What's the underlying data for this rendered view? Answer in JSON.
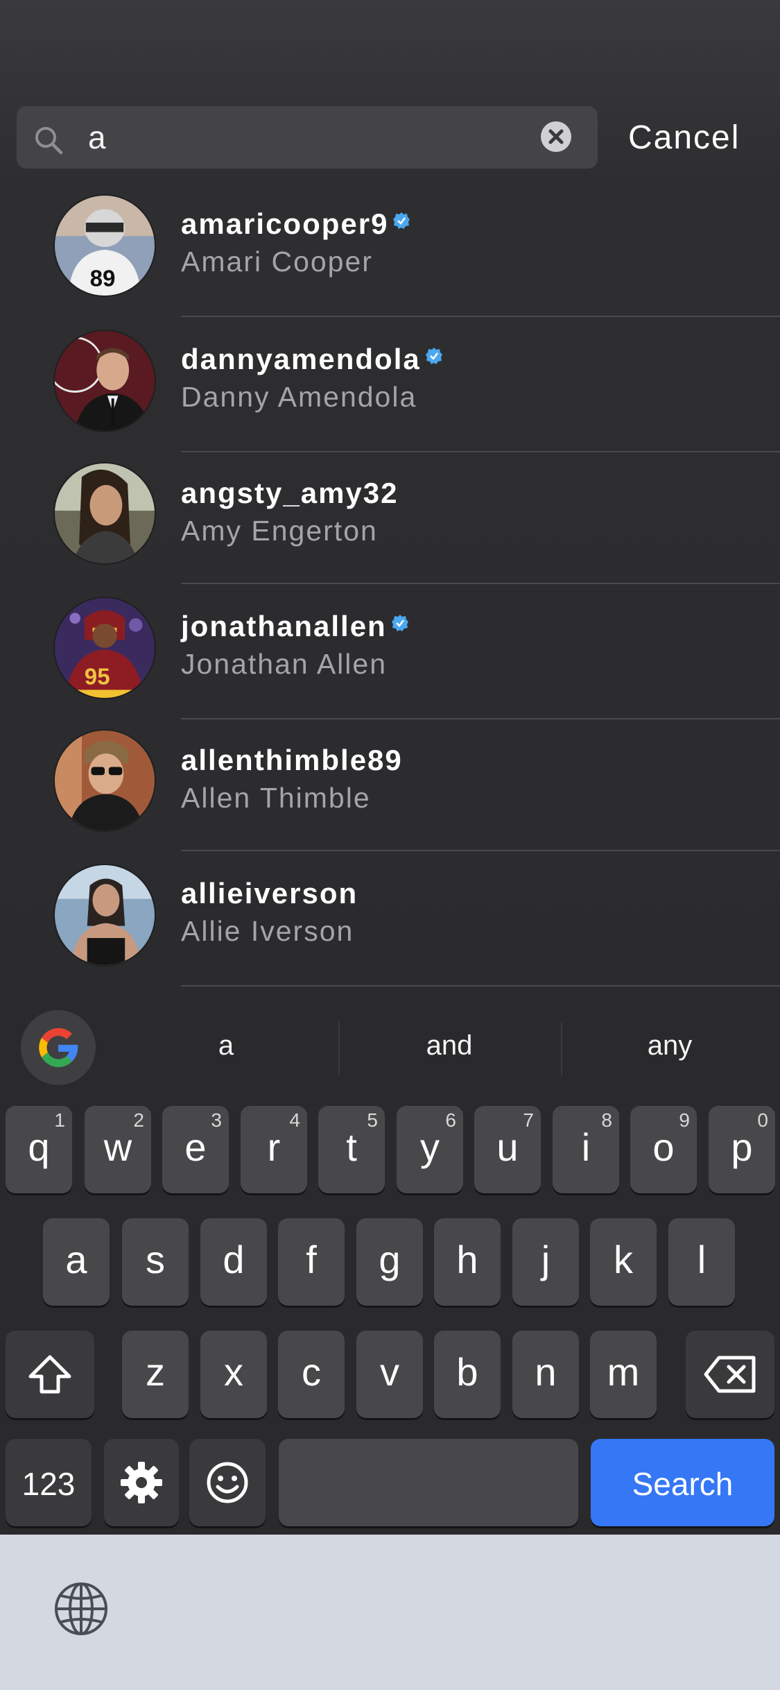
{
  "search": {
    "query": "a",
    "cancel_label": "Cancel"
  },
  "results": [
    {
      "username": "amaricooper9",
      "full_name": "Amari Cooper",
      "verified": true
    },
    {
      "username": "dannyamendola",
      "full_name": "Danny Amendola",
      "verified": true
    },
    {
      "username": "angsty_amy32",
      "full_name": "Amy Engerton",
      "verified": false
    },
    {
      "username": "jonathanallen",
      "full_name": "Jonathan Allen",
      "verified": true
    },
    {
      "username": "allenthimble89",
      "full_name": "Allen Thimble",
      "verified": false
    },
    {
      "username": "allieiverson",
      "full_name": "Allie Iverson",
      "verified": false
    }
  ],
  "keyboard": {
    "suggestions": [
      "a",
      "and",
      "any"
    ],
    "row1": [
      {
        "ch": "q",
        "num": "1"
      },
      {
        "ch": "w",
        "num": "2"
      },
      {
        "ch": "e",
        "num": "3"
      },
      {
        "ch": "r",
        "num": "4"
      },
      {
        "ch": "t",
        "num": "5"
      },
      {
        "ch": "y",
        "num": "6"
      },
      {
        "ch": "u",
        "num": "7"
      },
      {
        "ch": "i",
        "num": "8"
      },
      {
        "ch": "o",
        "num": "9"
      },
      {
        "ch": "p",
        "num": "0"
      }
    ],
    "row2": [
      "a",
      "s",
      "d",
      "f",
      "g",
      "h",
      "j",
      "k",
      "l"
    ],
    "row3": [
      "z",
      "x",
      "c",
      "v",
      "b",
      "n",
      "m"
    ],
    "numbers_label": "123",
    "search_label": "Search"
  },
  "colors": {
    "background": "#2c2c2e",
    "search_key": "#3577f5",
    "verified_badge": "#4aa8f0"
  }
}
